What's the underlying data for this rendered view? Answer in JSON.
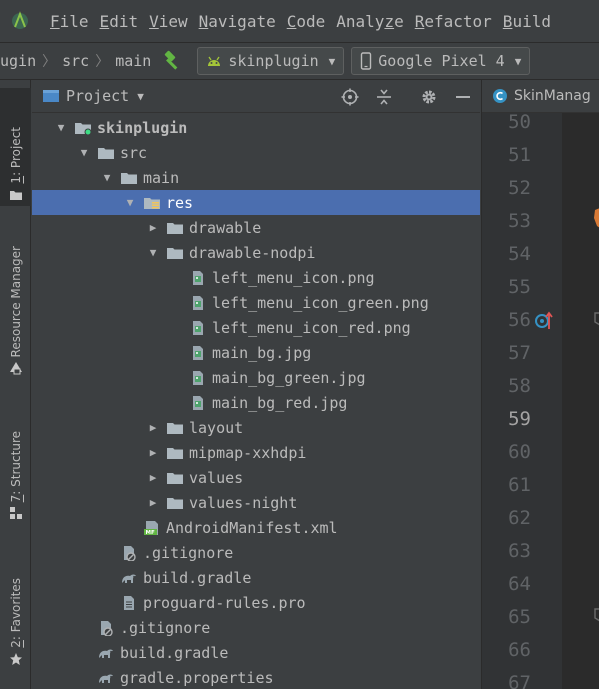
{
  "menu": {
    "items": [
      {
        "mnemonic": "F",
        "rest": "ile"
      },
      {
        "mnemonic": "E",
        "rest": "dit"
      },
      {
        "mnemonic": "V",
        "rest": "iew"
      },
      {
        "mnemonic": "N",
        "rest": "avigate"
      },
      {
        "mnemonic": "C",
        "rest": "ode"
      },
      {
        "pre": "Analy",
        "mnemonic": "z",
        "rest": "e"
      },
      {
        "mnemonic": "R",
        "rest": "efactor"
      },
      {
        "mnemonic": "B",
        "rest": "uild"
      }
    ]
  },
  "navbar": {
    "breadcrumbs": [
      "ugin",
      "src",
      "main"
    ],
    "run_config": "skinplugin",
    "device": "Google Pixel 4"
  },
  "stripe": {
    "project": {
      "mnemonic": "1",
      "rest": ": Project"
    },
    "resource_manager": "Resource Manager",
    "structure": {
      "mnemonic": "7",
      "rest": ": Structure"
    },
    "favorites": {
      "mnemonic": "2",
      "rest": ": Favorites"
    }
  },
  "panel": {
    "title": "Project",
    "tree": [
      {
        "label": "skinplugin",
        "depth": 1,
        "toggle": "open",
        "icon": "module-folder",
        "bold": true
      },
      {
        "label": "src",
        "depth": 2,
        "toggle": "open",
        "icon": "folder"
      },
      {
        "label": "main",
        "depth": 3,
        "toggle": "open",
        "icon": "folder"
      },
      {
        "label": "res",
        "depth": 4,
        "toggle": "open",
        "icon": "res-folder",
        "selected": true
      },
      {
        "label": "drawable",
        "depth": 5,
        "toggle": "closed",
        "icon": "folder"
      },
      {
        "label": "drawable-nodpi",
        "depth": 5,
        "toggle": "open",
        "icon": "folder"
      },
      {
        "label": "left_menu_icon.png",
        "depth": 6,
        "toggle": "none",
        "icon": "image-file"
      },
      {
        "label": "left_menu_icon_green.png",
        "depth": 6,
        "toggle": "none",
        "icon": "image-file"
      },
      {
        "label": "left_menu_icon_red.png",
        "depth": 6,
        "toggle": "none",
        "icon": "image-file"
      },
      {
        "label": "main_bg.jpg",
        "depth": 6,
        "toggle": "none",
        "icon": "image-file"
      },
      {
        "label": "main_bg_green.jpg",
        "depth": 6,
        "toggle": "none",
        "icon": "image-file"
      },
      {
        "label": "main_bg_red.jpg",
        "depth": 6,
        "toggle": "none",
        "icon": "image-file"
      },
      {
        "label": "layout",
        "depth": 5,
        "toggle": "closed",
        "icon": "folder"
      },
      {
        "label": "mipmap-xxhdpi",
        "depth": 5,
        "toggle": "closed",
        "icon": "folder"
      },
      {
        "label": "values",
        "depth": 5,
        "toggle": "closed",
        "icon": "folder"
      },
      {
        "label": "values-night",
        "depth": 5,
        "toggle": "closed",
        "icon": "folder"
      },
      {
        "label": "AndroidManifest.xml",
        "depth": 4,
        "toggle": "none",
        "icon": "manifest-file"
      },
      {
        "label": ".gitignore",
        "depth": 3,
        "toggle": "none",
        "icon": "gitignore-file"
      },
      {
        "label": "build.gradle",
        "depth": 3,
        "toggle": "none",
        "icon": "gradle-file"
      },
      {
        "label": "proguard-rules.pro",
        "depth": 3,
        "toggle": "none",
        "icon": "text-file"
      },
      {
        "label": ".gitignore",
        "depth": 2,
        "toggle": "none",
        "icon": "gitignore-file"
      },
      {
        "label": "build.gradle",
        "depth": 2,
        "toggle": "none",
        "icon": "gradle-file"
      },
      {
        "label": "gradle.properties",
        "depth": 2,
        "toggle": "none",
        "icon": "gradle-file"
      }
    ]
  },
  "editor": {
    "tab_label": "SkinManag",
    "line_numbers": [
      "50",
      "51",
      "52",
      "53",
      "54",
      "55",
      "56",
      "57",
      "58",
      "59",
      "60",
      "61",
      "62",
      "63",
      "64",
      "65",
      "66",
      "67"
    ],
    "current_line": "59"
  },
  "colors": {
    "background": "#3c3f41",
    "selection": "#4b6eaf",
    "folder": "#aeb9c0",
    "android_green": "#a4c639",
    "gutter": "#313335",
    "editor_bg": "#2b2b2b"
  }
}
